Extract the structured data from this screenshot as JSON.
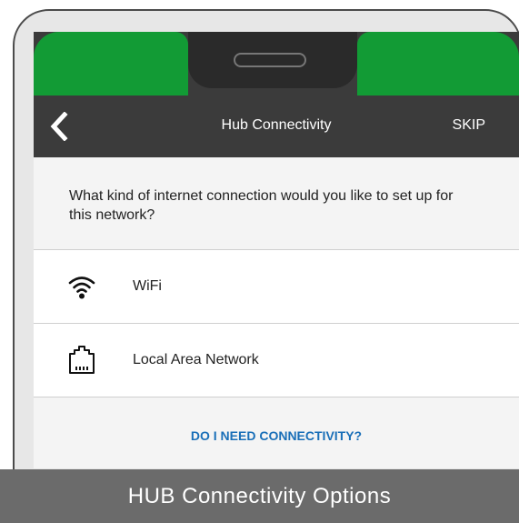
{
  "app_bar": {
    "title": "Hub Connectivity",
    "skip_label": "SKIP",
    "back_icon": "chevron-left-icon"
  },
  "question": "What kind of internet connection would you like to set up for this network?",
  "options": [
    {
      "label": "WiFi",
      "icon": "wifi-icon"
    },
    {
      "label": "Local Area Network",
      "icon": "ethernet-port-icon"
    }
  ],
  "help_link": "DO I NEED CONNECTIVITY?",
  "caption": "HUB Connectivity Options",
  "colors": {
    "status_green": "#129b35",
    "app_bar": "#3b3b3b",
    "link_blue": "#1a6fb8",
    "caption_bg": "#6b6b6b"
  }
}
